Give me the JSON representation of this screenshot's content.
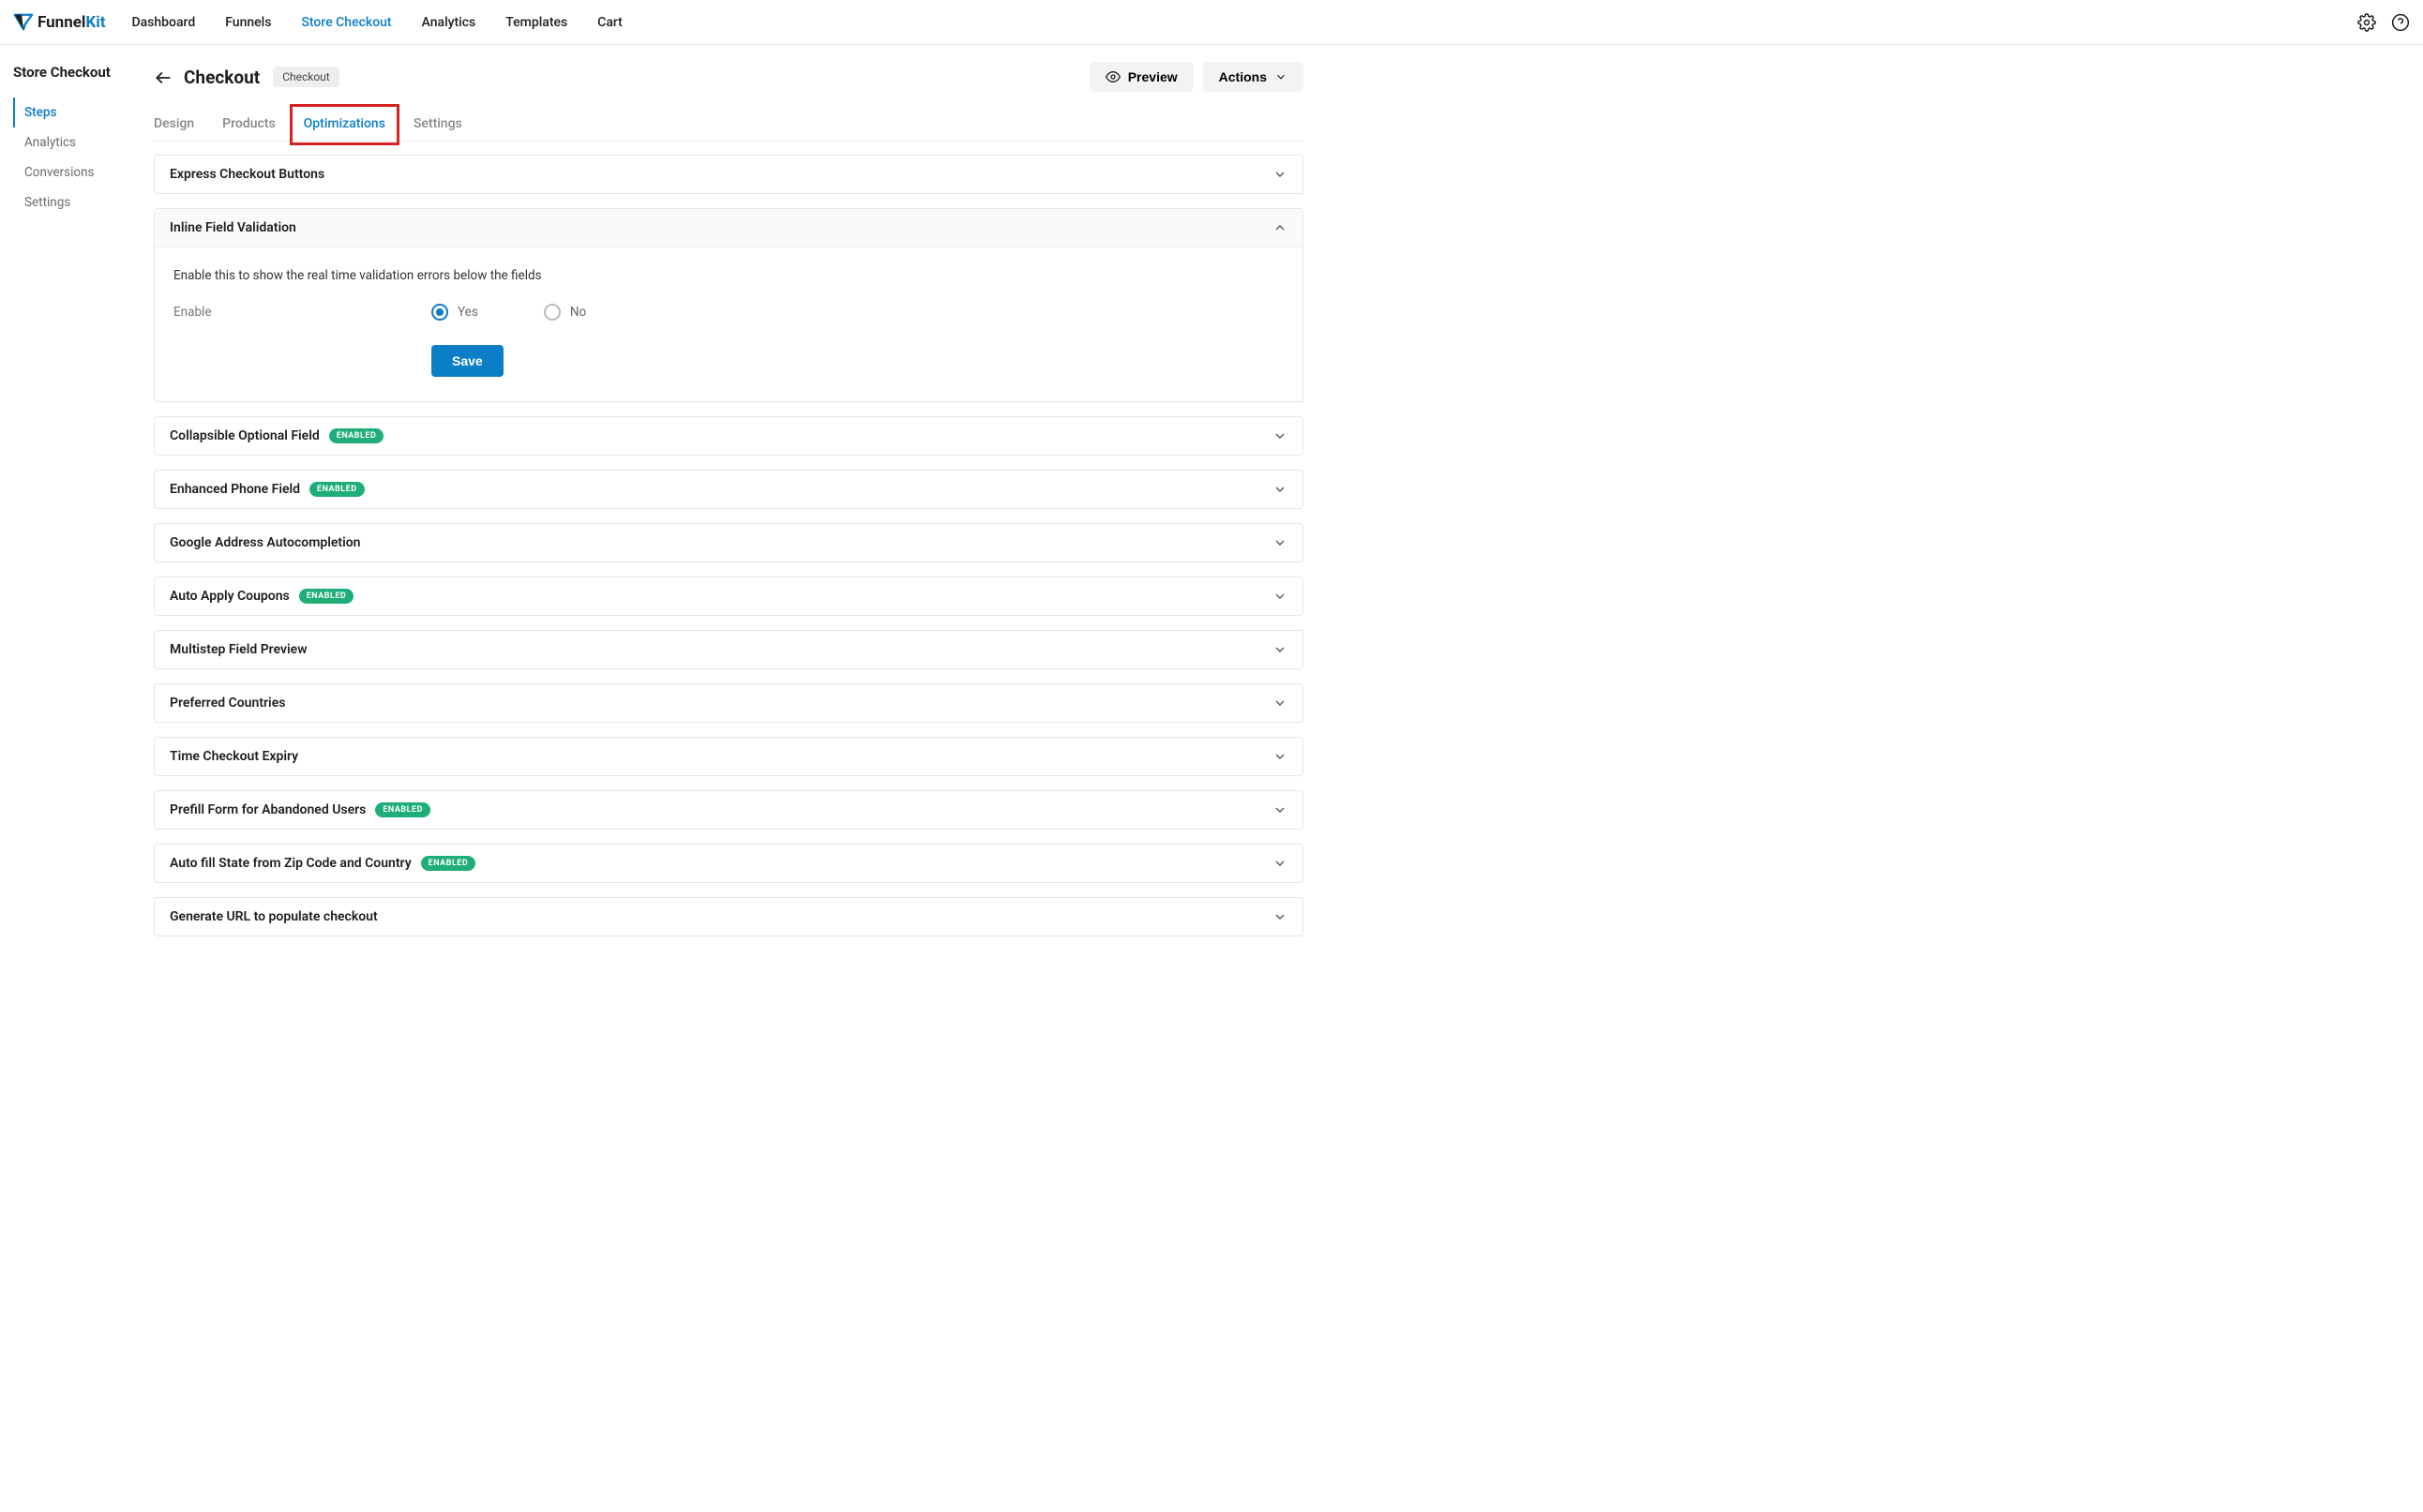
{
  "brand": {
    "name_a": "Funnel",
    "name_b": "Kit"
  },
  "topnav": {
    "items": [
      "Dashboard",
      "Funnels",
      "Store Checkout",
      "Analytics",
      "Templates",
      "Cart"
    ],
    "active_index": 2
  },
  "sidebar": {
    "title": "Store Checkout",
    "items": [
      "Steps",
      "Analytics",
      "Conversions",
      "Settings"
    ],
    "active_index": 0
  },
  "page": {
    "title": "Checkout",
    "badge": "Checkout",
    "preview_label": "Preview",
    "actions_label": "Actions"
  },
  "tabs": {
    "items": [
      "Design",
      "Products",
      "Optimizations",
      "Settings"
    ],
    "active_index": 2
  },
  "accordions": [
    {
      "title": "Express Checkout Buttons",
      "enabled_badge": false,
      "open": false
    },
    {
      "title": "Inline Field Validation",
      "enabled_badge": false,
      "open": true,
      "body": {
        "desc": "Enable this to show the real time validation errors below the fields",
        "enable_label": "Enable",
        "yes_label": "Yes",
        "no_label": "No",
        "selected": "yes",
        "save_label": "Save"
      }
    },
    {
      "title": "Collapsible Optional Field",
      "enabled_badge": true,
      "open": false
    },
    {
      "title": "Enhanced Phone Field",
      "enabled_badge": true,
      "open": false
    },
    {
      "title": "Google Address Autocompletion",
      "enabled_badge": false,
      "open": false
    },
    {
      "title": "Auto Apply Coupons",
      "enabled_badge": true,
      "open": false
    },
    {
      "title": "Multistep Field Preview",
      "enabled_badge": false,
      "open": false
    },
    {
      "title": "Preferred Countries",
      "enabled_badge": false,
      "open": false
    },
    {
      "title": "Time Checkout Expiry",
      "enabled_badge": false,
      "open": false
    },
    {
      "title": "Prefill Form for Abandoned Users",
      "enabled_badge": true,
      "open": false
    },
    {
      "title": "Auto fill State from Zip Code and Country",
      "enabled_badge": true,
      "open": false
    },
    {
      "title": "Generate URL to populate checkout",
      "enabled_badge": false,
      "open": false
    }
  ],
  "badge_text": "ENABLED"
}
